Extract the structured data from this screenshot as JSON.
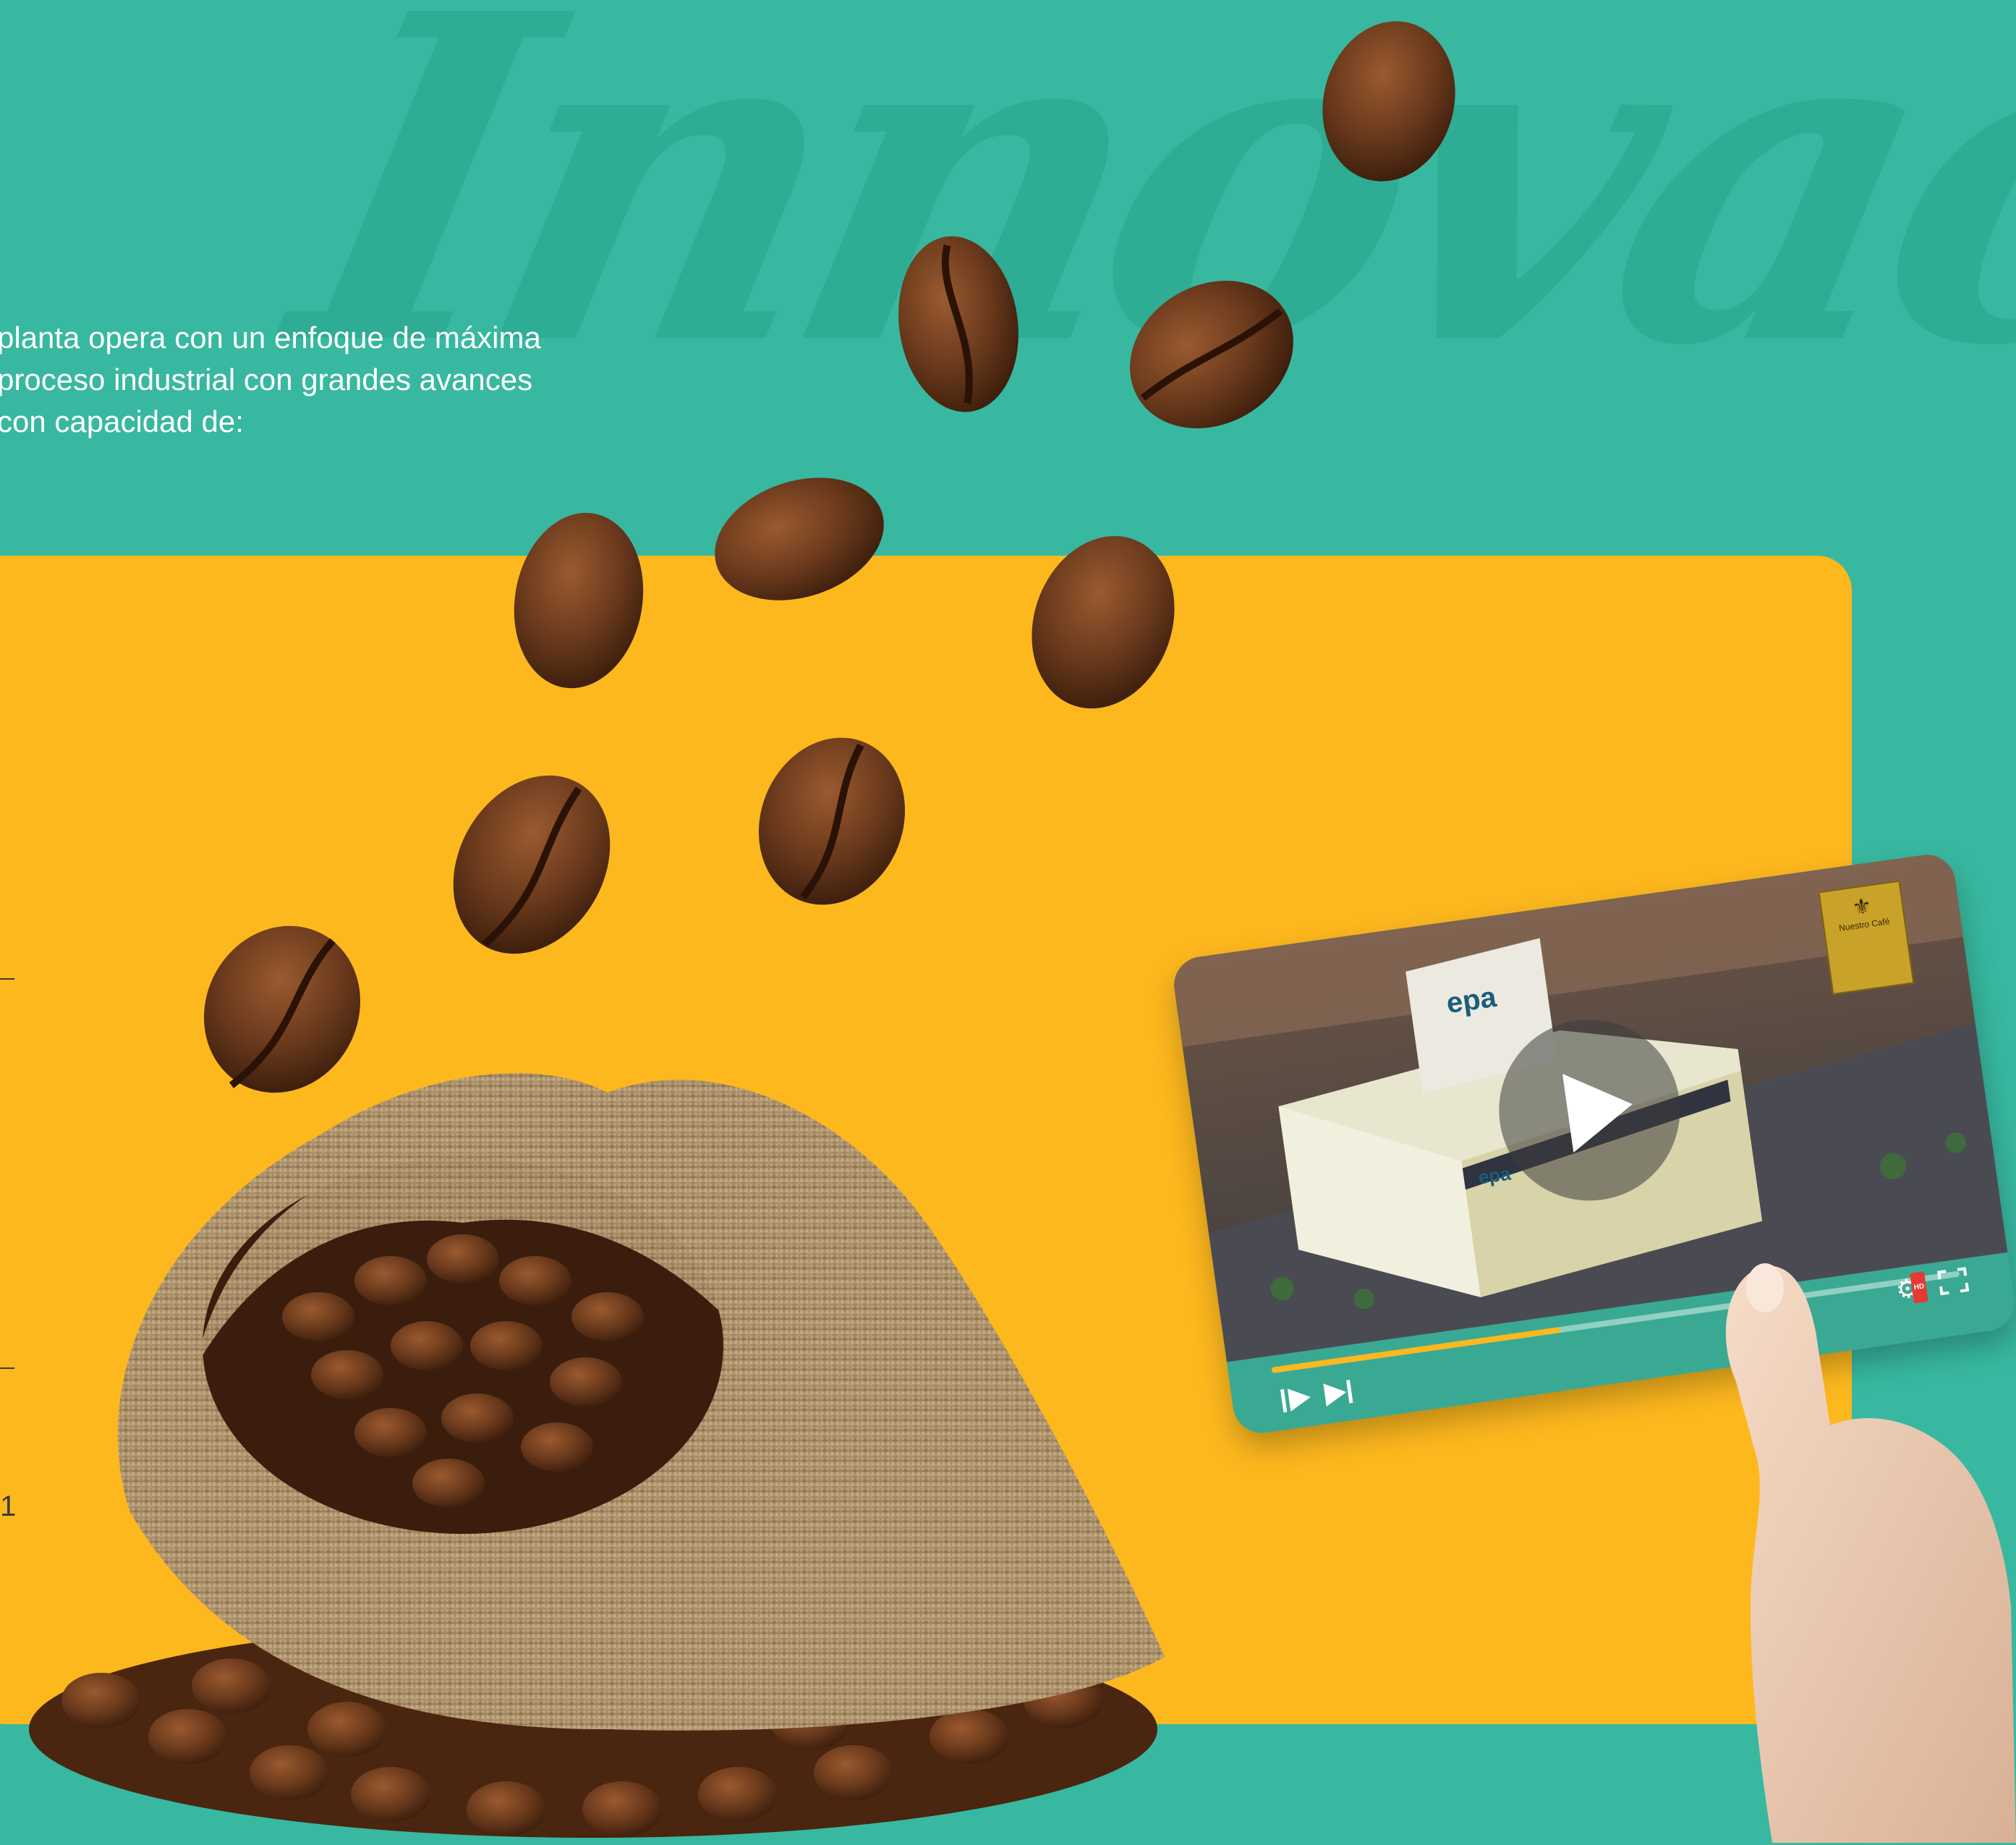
{
  "background": {
    "teal": "#38b8a0",
    "panel_yellow": "#fdb81e"
  },
  "watermark": {
    "text": "Innovación"
  },
  "intro": {
    "text": "planta opera con un enfoque de máxima\n proceso industrial con grandes avances\ncon capacidad de:"
  },
  "edge": {
    "digit": "1"
  },
  "video": {
    "progress": 0.42,
    "play_icon": "play-icon",
    "step_icon": "step-play-icon",
    "next_icon": "skip-next-icon",
    "settings_icon": "gear-icon",
    "hd_label": "HD",
    "fullscreen_icon": "fullscreen-icon",
    "building_logo": "epa",
    "badge_caption": "Nuestro Café"
  }
}
